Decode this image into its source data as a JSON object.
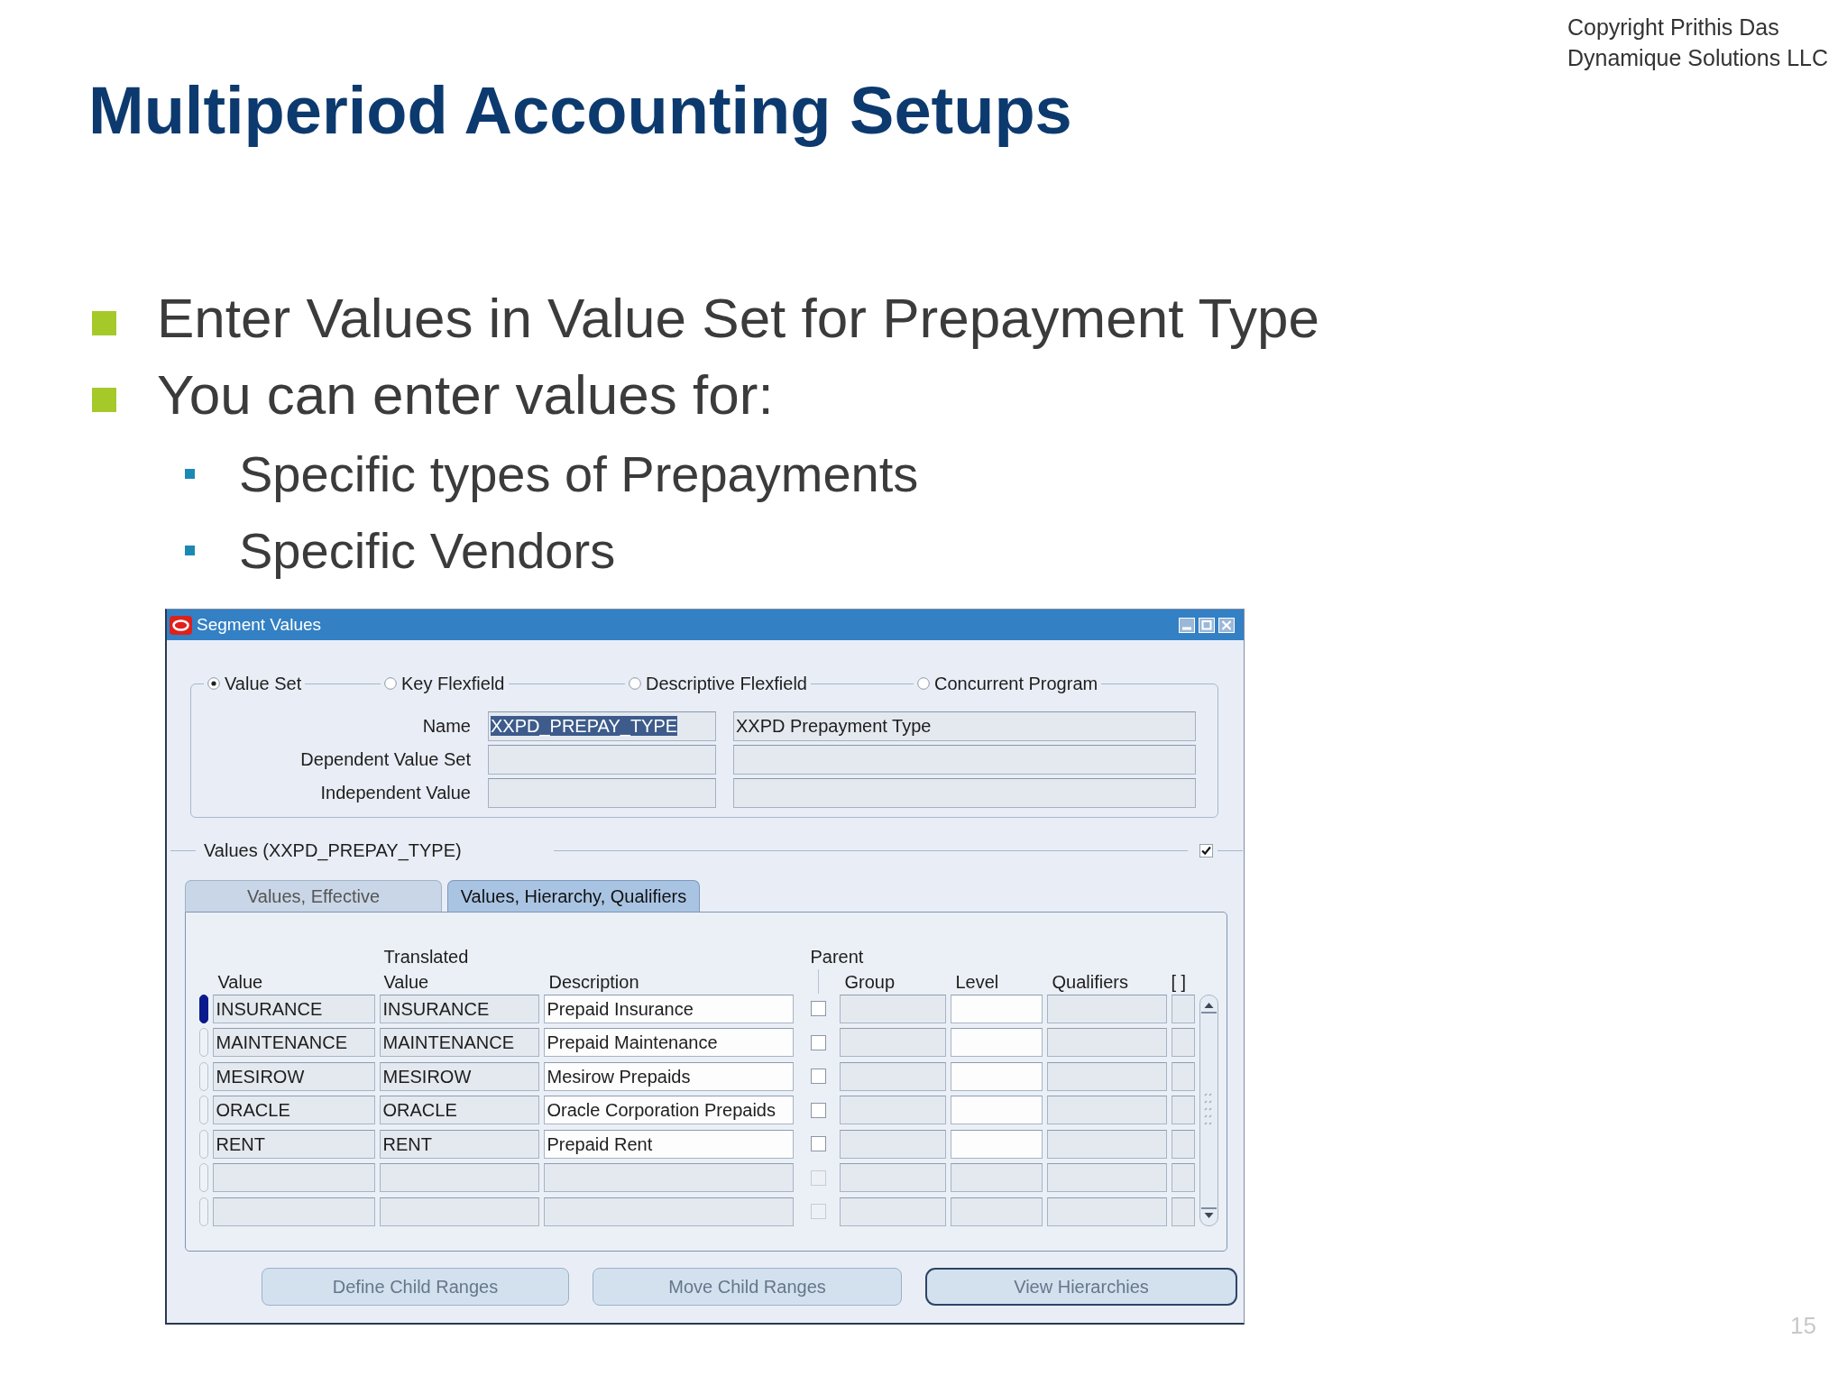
{
  "copyright": [
    "Copyright Prithis Das",
    "Dynamique Solutions LLC"
  ],
  "title": "Multiperiod Accounting Setups",
  "bullets": [
    {
      "text": "Enter Values in Value Set for Prepayment Type"
    },
    {
      "text": "You can enter values for:",
      "children": [
        {
          "text": "Specific types of Prepayments"
        },
        {
          "text": "Specific Vendors"
        }
      ]
    }
  ],
  "window": {
    "title": "Segment Values",
    "source_options": [
      {
        "label": "Value Set",
        "selected": true
      },
      {
        "label": "Key Flexfield",
        "selected": false
      },
      {
        "label": "Descriptive Flexfield",
        "selected": false
      },
      {
        "label": "Concurrent Program",
        "selected": false
      }
    ],
    "fields": [
      {
        "label": "Name",
        "value": "XXPD_PREPAY_TYPE",
        "highlighted": true,
        "description": "XXPD Prepayment Type"
      },
      {
        "label": "Dependent Value Set"
      },
      {
        "label": "Independent Value"
      }
    ],
    "values_section": {
      "title": "Values (XXPD_PREPAY_TYPE)",
      "checked": true
    },
    "tabs": [
      {
        "label": "Values, Effective",
        "selected": false
      },
      {
        "label": "Values, Hierarchy, Qualifiers",
        "selected": true
      }
    ],
    "table": {
      "columns": [
        "Value",
        "Translated Value",
        "Description",
        "Parent",
        "Group",
        "Level",
        "Qualifiers",
        "[ ]"
      ],
      "rows": [
        {
          "value": "INSURANCE",
          "translated_value": "INSURANCE",
          "description": "Prepaid Insurance",
          "parent": false,
          "current": true,
          "editable": true
        },
        {
          "value": "MAINTENANCE",
          "translated_value": "MAINTENANCE",
          "description": "Prepaid Maintenance",
          "parent": false,
          "current": false,
          "editable": true
        },
        {
          "value": "MESIROW",
          "translated_value": "MESIROW",
          "description": "Mesirow Prepaids",
          "parent": false,
          "current": false,
          "editable": true
        },
        {
          "value": "ORACLE",
          "translated_value": "ORACLE",
          "description": "Oracle Corporation Prepaids",
          "parent": false,
          "current": false,
          "editable": true
        },
        {
          "value": "RENT",
          "translated_value": "RENT",
          "description": "Prepaid Rent",
          "parent": false,
          "current": false,
          "editable": true
        },
        {
          "parent": false,
          "current": false,
          "editable": false
        },
        {
          "parent": false,
          "current": false,
          "editable": false
        }
      ]
    },
    "buttons": [
      {
        "label": "Define Child Ranges",
        "default": false
      },
      {
        "label": "Move Child Ranges",
        "default": false
      },
      {
        "label": "View Hierarchies",
        "default": true
      }
    ]
  },
  "slide_number": "15"
}
